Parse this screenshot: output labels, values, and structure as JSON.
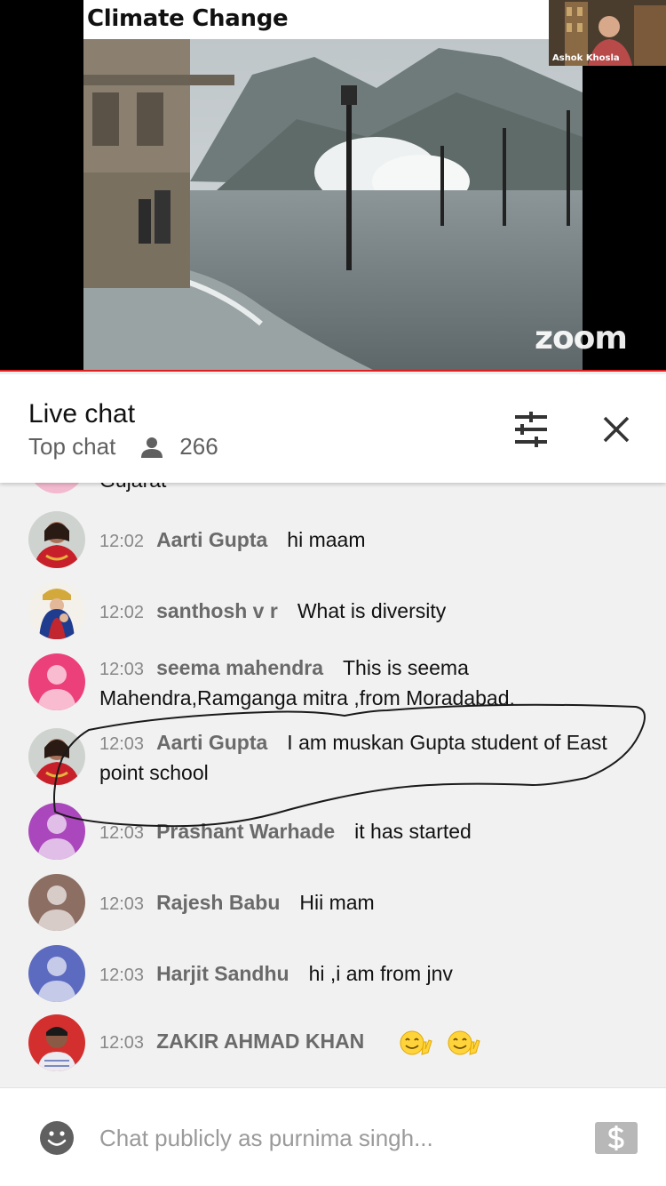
{
  "video": {
    "slide_title": "Climate Change",
    "speaker_name": "Ashok Khosla",
    "watermark": "zoom",
    "progress_fraction": 1.0,
    "progress_color": "#e02020"
  },
  "chat_header": {
    "title": "Live chat",
    "mode": "Top chat",
    "viewer_count": "266",
    "icons": [
      "person-icon",
      "filter-sliders-icon",
      "close-icon"
    ]
  },
  "partial_message": {
    "text": "Gujarat"
  },
  "messages": [
    {
      "time": "12:02",
      "author": "Aarti Gupta",
      "text": "hi maam",
      "avatar": "photo"
    },
    {
      "time": "12:02",
      "author": "santhosh v r",
      "text": "What is diversity",
      "avatar": "photo"
    },
    {
      "time": "12:03",
      "author": "seema mahendra",
      "text": "This is seema Mahendra,Ramganga mitra ,from Moradabad.",
      "avatar": "default",
      "avatar_color": "#ec407a"
    },
    {
      "time": "12:03",
      "author": "Aarti Gupta",
      "text": "I am muskan Gupta student of East point school",
      "avatar": "photo"
    },
    {
      "time": "12:03",
      "author": "Prashant Warhade",
      "text": "it has started",
      "avatar": "default",
      "avatar_color": "#ab47bc"
    },
    {
      "time": "12:03",
      "author": "Rajesh Babu",
      "text": "Hii mam",
      "avatar": "default",
      "avatar_color": "#8d6e63"
    },
    {
      "time": "12:03",
      "author": "Harjit Sandhu",
      "text": "hi ,i am from jnv",
      "avatar": "default",
      "avatar_color": "#5c6bc0"
    },
    {
      "time": "12:03",
      "author": "ZAKIR AHMAD KHAN",
      "text": "",
      "emojis": [
        "smile-victory-emoji",
        "smile-victory-emoji"
      ],
      "avatar": "photo"
    }
  ],
  "input": {
    "placeholder": "Chat publicly as purnima singh...",
    "value": ""
  }
}
